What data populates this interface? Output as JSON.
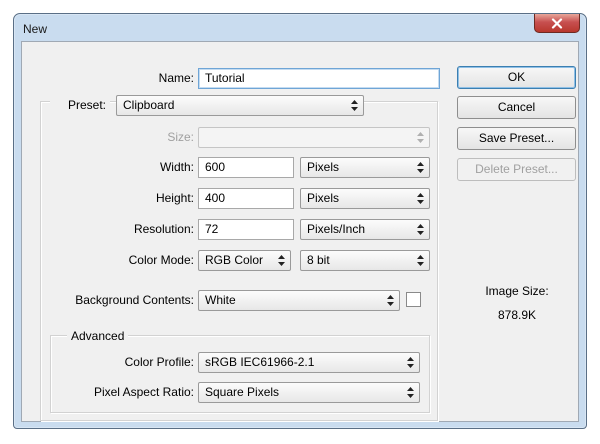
{
  "window": {
    "title": "New"
  },
  "form": {
    "name_label": "Name:",
    "name_value": "Tutorial",
    "preset_label": "Preset:",
    "preset_value": "Clipboard",
    "size_label": "Size:",
    "size_value": "",
    "width_label": "Width:",
    "width_value": "600",
    "width_unit": "Pixels",
    "height_label": "Height:",
    "height_value": "400",
    "height_unit": "Pixels",
    "resolution_label": "Resolution:",
    "resolution_value": "72",
    "resolution_unit": "Pixels/Inch",
    "color_mode_label": "Color Mode:",
    "color_mode_value": "RGB Color",
    "bit_depth_value": "8 bit",
    "background_label": "Background Contents:",
    "background_value": "White",
    "background_swatch_color": "#ffffff"
  },
  "advanced": {
    "legend": "Advanced",
    "color_profile_label": "Color Profile:",
    "color_profile_value": "sRGB IEC61966-2.1",
    "pixel_aspect_label": "Pixel Aspect Ratio:",
    "pixel_aspect_value": "Square Pixels"
  },
  "buttons": {
    "ok": "OK",
    "cancel": "Cancel",
    "save_preset": "Save Preset...",
    "delete_preset": "Delete Preset..."
  },
  "image_size": {
    "label": "Image Size:",
    "value": "878.9K"
  },
  "icons": {
    "close": "close-icon",
    "select_arrows": "updown-arrows-icon"
  }
}
